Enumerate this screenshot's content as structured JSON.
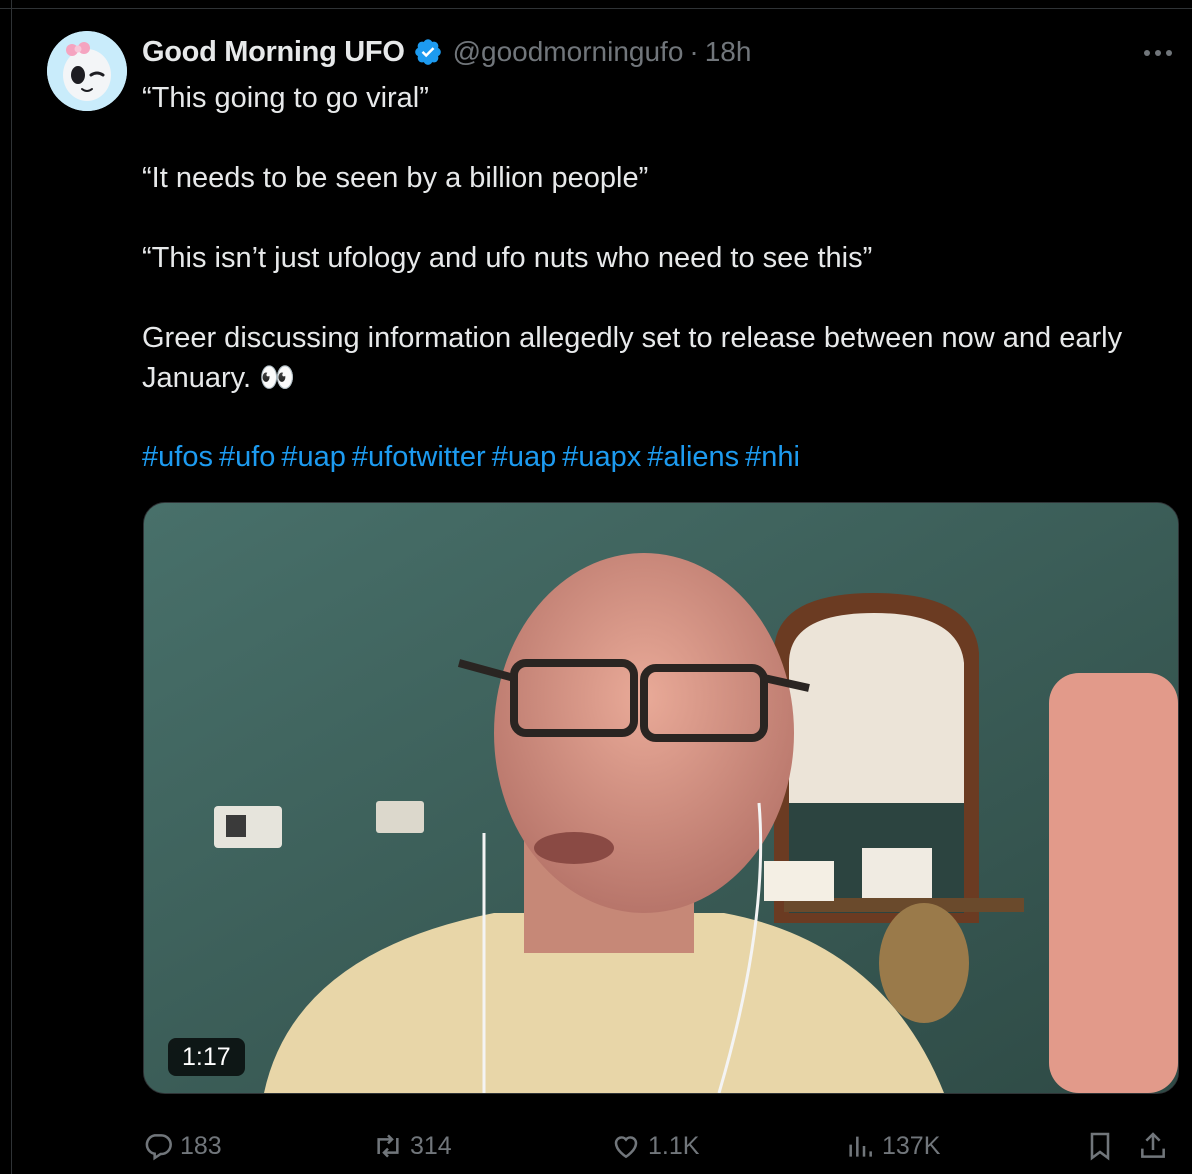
{
  "tweet": {
    "author": {
      "display_name": "Good Morning UFO",
      "handle": "@goodmorningufo",
      "verified": true,
      "avatar_icon": "alien-avatar-icon"
    },
    "separator": "·",
    "time": "18h",
    "more_icon": "more-dots-icon",
    "text_lines": [
      "“This going to go viral”",
      "“It needs to be seen by a billion people”",
      "“This isn’t just ufology and ufo nuts who need to see this”",
      "Greer discussing information allegedly set to release between now and early January. 👀"
    ],
    "hashtags": [
      "#ufos",
      "#ufo",
      "#uap",
      "#ufotwitter",
      "#uap",
      "#uapx",
      "#aliens",
      "#nhi"
    ],
    "media": {
      "type": "video",
      "duration": "1:17"
    },
    "metrics": {
      "replies": "183",
      "reposts": "314",
      "likes": "1.1K",
      "views": "137K"
    }
  },
  "colors": {
    "background": "#000000",
    "text": "#e7e9ea",
    "muted": "#71767b",
    "link": "#1d9bf0",
    "verified": "#1d9bf0"
  }
}
